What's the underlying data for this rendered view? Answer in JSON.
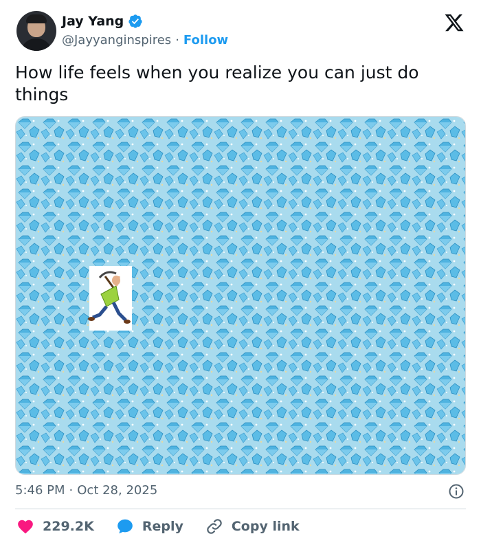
{
  "tweet": {
    "author": {
      "name": "Jay Yang",
      "handle": "@Jayyanginspires",
      "separator": "·",
      "follow_label": "Follow"
    },
    "text": "How life feels when you realize you can just do things",
    "timestamp": {
      "time": "5:46 PM",
      "separator": "·",
      "date": "Oct 28, 2025"
    },
    "actions": {
      "likes": "229.2K",
      "reply_label": "Reply",
      "copy_link_label": "Copy link"
    }
  },
  "colors": {
    "brand_blue": "#1d9bf0",
    "like_red": "#f91880",
    "muted": "#536471",
    "diamond_bg": "#9fd4ea"
  },
  "icons": [
    "verified-badge-icon",
    "x-logo-icon",
    "info-icon",
    "heart-icon",
    "reply-bubble-icon",
    "link-icon"
  ]
}
